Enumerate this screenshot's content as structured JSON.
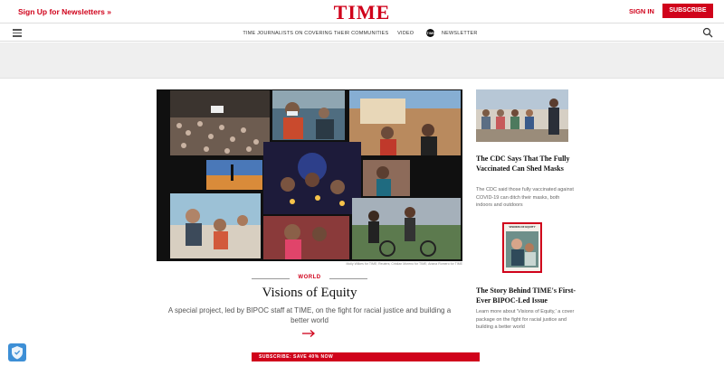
{
  "header": {
    "newsletter_link": "Sign Up for Newsletters »",
    "logo": "TIME",
    "signin": "SIGN IN",
    "subscribe": "SUBSCRIBE"
  },
  "nav": {
    "items": [
      "TIME JOURNALISTS ON COVERING THEIR COMMUNITIES",
      "VIDEO"
    ],
    "newsletter_badge": "TIME",
    "newsletter": "NEWSLETTER"
  },
  "hero": {
    "credit": "Molly Wilkes for TIME; Reuters; Cristian Moreno for TIME; Ariana Romero for TIME",
    "section": "WORLD",
    "title": "Visions of Equity",
    "description": "A special project, led by BIPOC staff at TIME, on the fight for racial justice and building a better world"
  },
  "bottom_bar": "SUBSCRIBE: SAVE 40% NOW",
  "sidebar": {
    "story1": {
      "title": "The CDC Says That The Fully Vaccinated Can Shed Masks",
      "desc": "The CDC said those fully vaccinated against COVID-19 can ditch their masks, both indoors and outdoors"
    },
    "cover_label": "VISIONS OF EQUITY",
    "story2": {
      "title": "The Story Behind TIME's First-Ever BIPOC-Led Issue",
      "desc": "Learn more about 'Visions of Equity,' a cover package on the fight for racial justice and building a better world"
    }
  },
  "colors": {
    "brand_red": "#d0021b",
    "ad_band": "#efefef",
    "shield_blue": "#3d8fd6"
  }
}
